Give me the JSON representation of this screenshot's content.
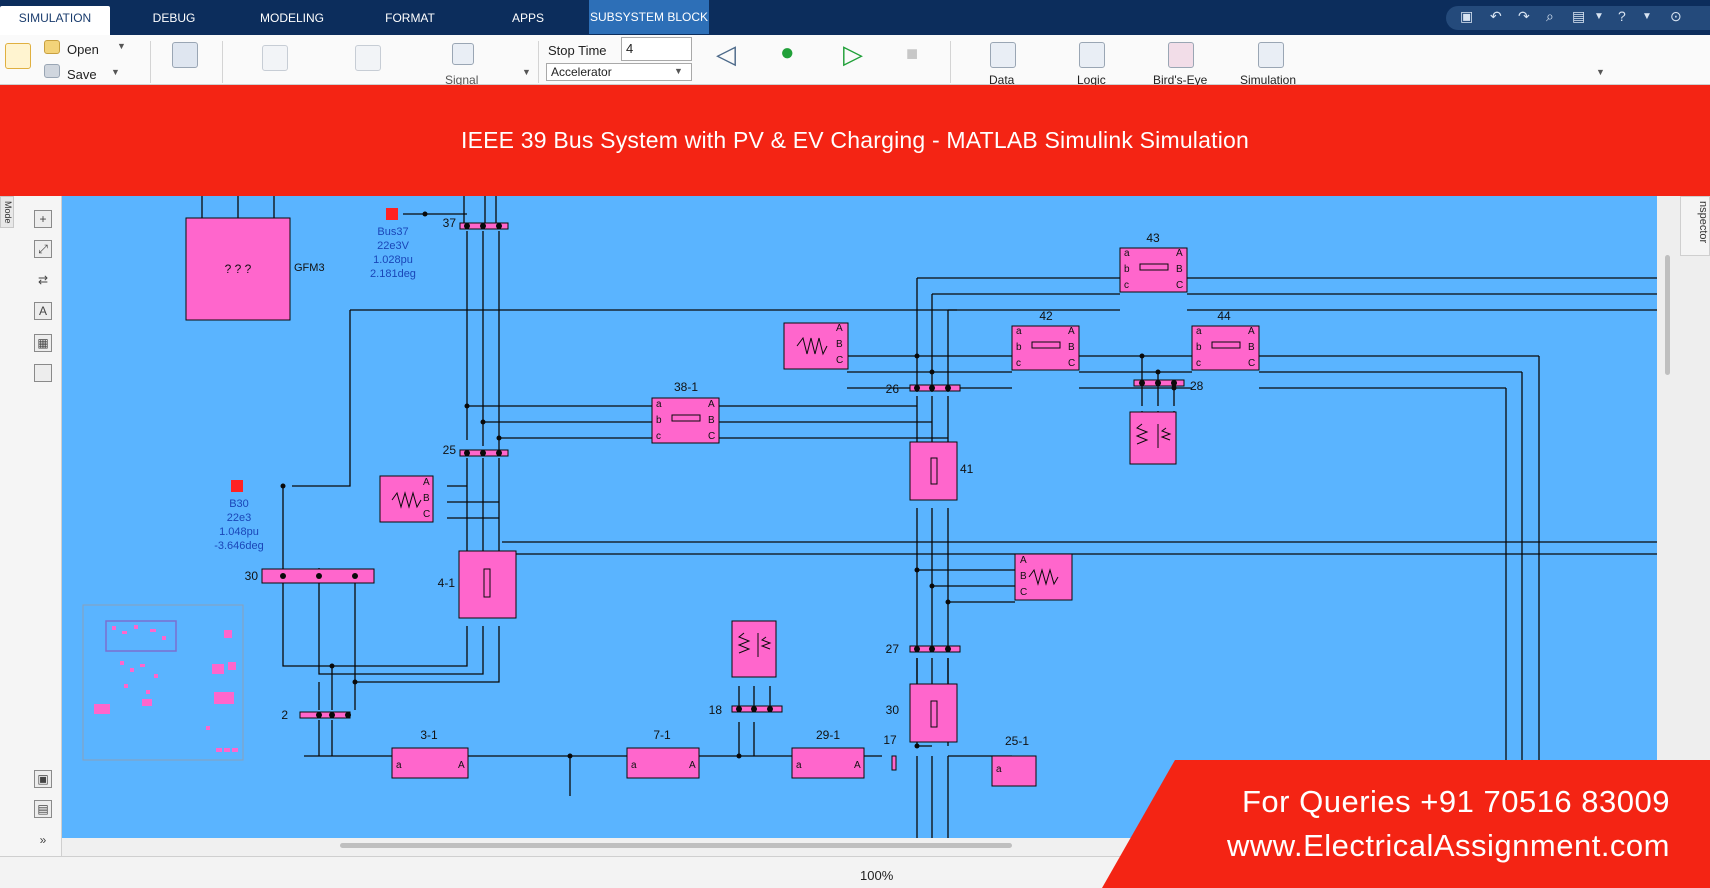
{
  "tabs": [
    {
      "label": "SIMULATION",
      "active": true
    },
    {
      "label": "DEBUG"
    },
    {
      "label": "MODELING"
    },
    {
      "label": "FORMAT"
    },
    {
      "label": "APPS"
    },
    {
      "label": "SUBSYSTEM BLOCK",
      "context": true
    }
  ],
  "toolstrip": {
    "open_label": "Open",
    "save_label": "Save",
    "signal_label": "Signal",
    "stop_time_label": "Stop Time",
    "stop_time_value": "4",
    "sim_mode": "Accelerator",
    "data_label": "Data",
    "logic_label": "Logic",
    "birdseye_label": "Bird's-Eye",
    "simulation_label": "Simulation"
  },
  "banner": {
    "title": "IEEE 39 Bus System with PV & EV Charging - MATLAB Simulink Simulation"
  },
  "side_tabs": {
    "model": "Mode",
    "inspector": "nspector"
  },
  "diagram": {
    "block_placeholder": "? ? ?",
    "gfm_label": "GFM3",
    "bus37_info": [
      "Bus37",
      "22e3V",
      "1.028pu",
      "2.181deg"
    ],
    "b30_info": [
      "B30",
      "22e3",
      "1.048pu",
      "-3.646deg"
    ],
    "labels": {
      "n37": "37",
      "n25": "25",
      "n30": "30",
      "n2": "2",
      "n4_1": "4-1",
      "n3_1": "3-1",
      "n7_1": "7-1",
      "n18": "18",
      "n29_1": "29-1",
      "n17": "17",
      "n25_1": "25-1",
      "n38_1": "38-1",
      "n26": "26",
      "n41": "41",
      "n27": "27",
      "n30b": "30",
      "n42": "42",
      "n43": "43",
      "n44": "44",
      "n28": "28"
    },
    "ports": {
      "a": "a",
      "b": "b",
      "c": "c",
      "A": "A",
      "B": "B",
      "C": "C"
    }
  },
  "status": {
    "zoom": "100%"
  },
  "promo": {
    "line1": "For Queries +91 70516 83009",
    "line2": "www.ElectricalAssignment.com"
  },
  "colors": {
    "canvas": "#5ab4ff",
    "block": "#ff66cc",
    "banner": "#f42414",
    "tabbar": "#0c2d5c"
  }
}
